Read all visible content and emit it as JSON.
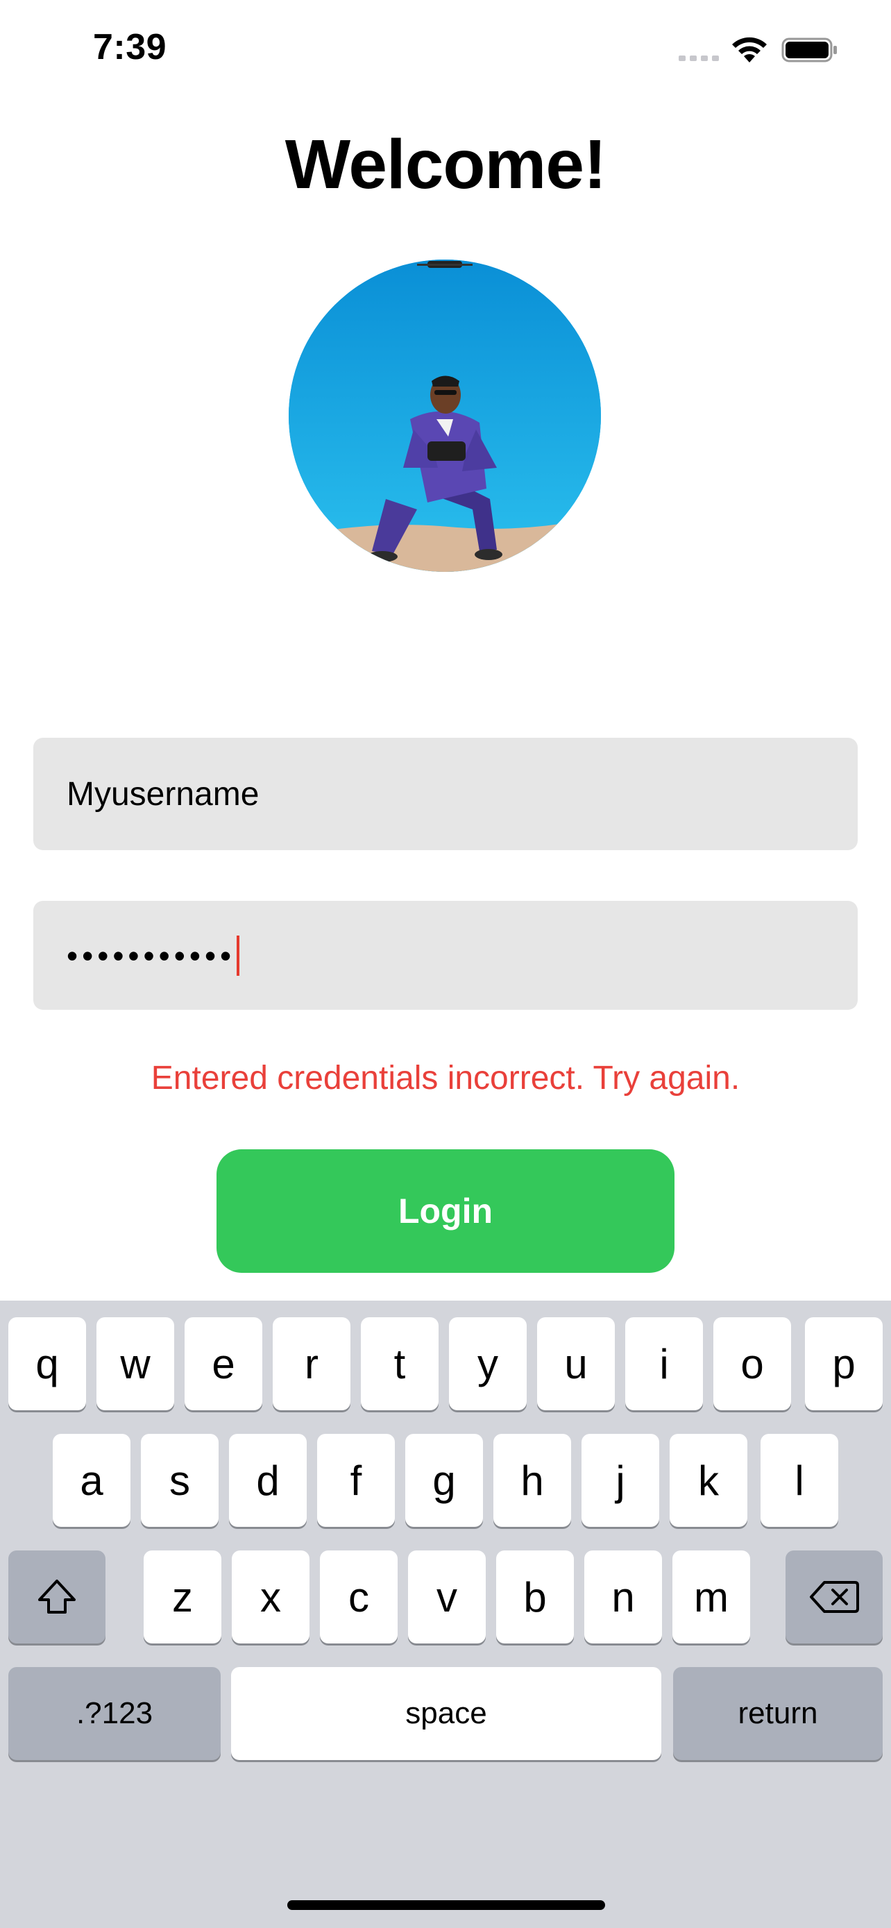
{
  "status_bar": {
    "time": "7:39"
  },
  "screen": {
    "title": "Welcome!",
    "avatar_alt": "",
    "username_value": "Myusername",
    "password_masked": "•••••••••••",
    "error_message": "Entered credentials incorrect. Try again.",
    "login_label": "Login"
  },
  "keyboard": {
    "row1": [
      "q",
      "w",
      "e",
      "r",
      "t",
      "y",
      "u",
      "i",
      "o",
      "p"
    ],
    "row2": [
      "a",
      "s",
      "d",
      "f",
      "g",
      "h",
      "j",
      "k",
      "l"
    ],
    "row3": [
      "z",
      "x",
      "c",
      "v",
      "b",
      "n",
      "m"
    ],
    "numbers_label": ".?123",
    "space_label": "space",
    "return_label": "return"
  },
  "colors": {
    "accent_green": "#34c85a",
    "error_red": "#e9403a",
    "field_bg": "#e6e6e6",
    "keyboard_bg": "#d3d5db"
  }
}
